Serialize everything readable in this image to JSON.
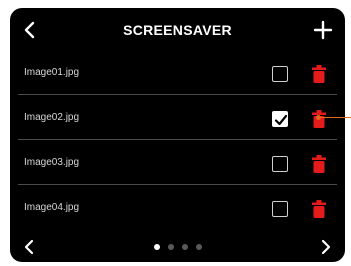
{
  "screen": {
    "title": "SCREENSAVER",
    "background": "#000000",
    "accent": "#e31b1b"
  },
  "header": {
    "back_icon": "chevron-left-icon",
    "add_icon": "plus-icon"
  },
  "files": [
    {
      "name": "Image01.jpg",
      "selected": false
    },
    {
      "name": "Image02.jpg",
      "selected": true
    },
    {
      "name": "Image03.jpg",
      "selected": false
    },
    {
      "name": "Image04.jpg",
      "selected": false
    }
  ],
  "pagination": {
    "current_page": 1,
    "total_pages": 4
  },
  "callout_color": "#e3681e"
}
